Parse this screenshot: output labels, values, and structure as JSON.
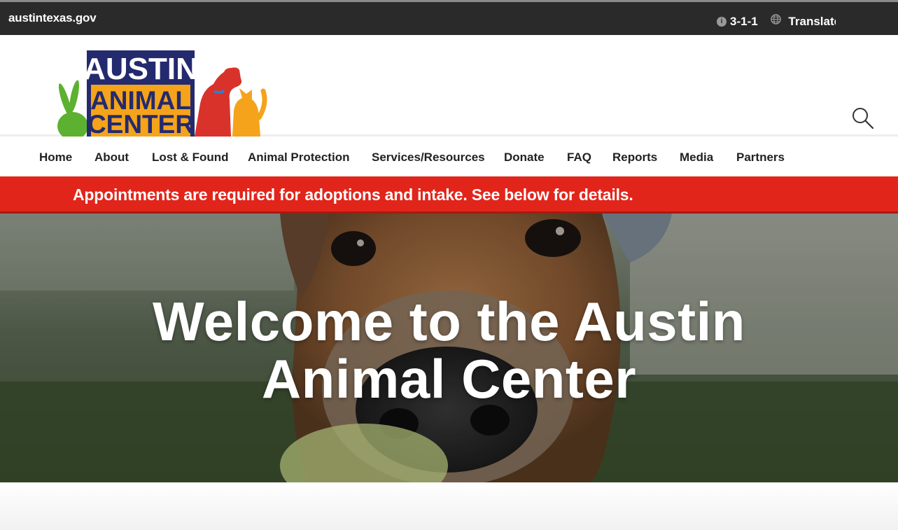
{
  "topbar": {
    "site_link": "austintexas.gov",
    "phone_label": "3-1-1",
    "translate_label": "Translate"
  },
  "logo": {
    "line1": "AUSTIN",
    "line2": "ANIMAL",
    "line3": "CENTER"
  },
  "nav": {
    "items": [
      "Home",
      "About",
      "Lost & Found",
      "Animal Protection",
      "Services/Resources",
      "Donate",
      "FAQ",
      "Reports",
      "Media",
      "Partners"
    ]
  },
  "alert": {
    "message": "Appointments are required for adoptions and intake. See below for details."
  },
  "hero": {
    "title_line1": "Welcome to the Austin",
    "title_line2": "Animal Center"
  },
  "colors": {
    "topbar": "#2a2a2a",
    "alert": "#e1251b",
    "logo_navy": "#232a6e",
    "logo_orange": "#f5a31a",
    "logo_red": "#d9322a",
    "logo_green": "#5cb130"
  },
  "icons": {
    "info": "info-icon",
    "globe": "globe-icon",
    "search": "search-icon"
  }
}
